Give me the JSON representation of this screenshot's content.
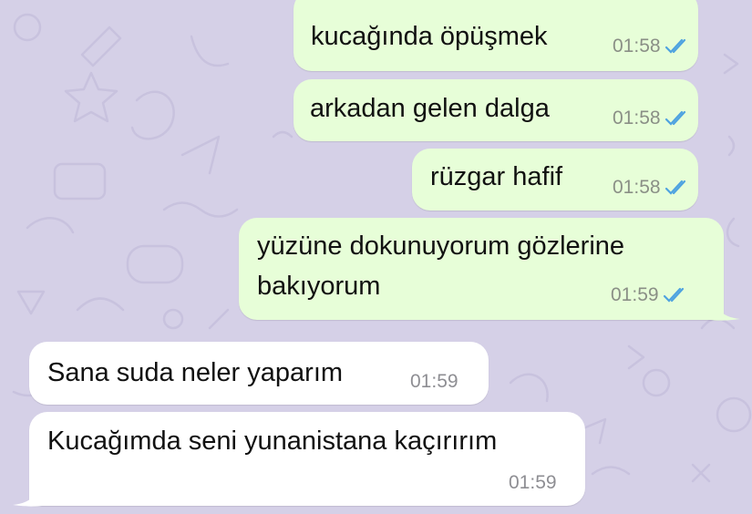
{
  "messages": [
    {
      "direction": "outgoing",
      "text": "kucağında öpüşmek",
      "time": "01:58",
      "status": "read-double-check-icon"
    },
    {
      "direction": "outgoing",
      "text": "arkadan gelen dalga",
      "time": "01:58",
      "status": "read-double-check-icon"
    },
    {
      "direction": "outgoing",
      "text": "rüzgar hafif",
      "time": "01:58",
      "status": "read-double-check-icon"
    },
    {
      "direction": "outgoing",
      "text_line1": "yüzüne dokunuyorum gözlerine",
      "text_line2": "bakıyorum",
      "time": "01:59",
      "status": "read-double-check-icon"
    },
    {
      "direction": "incoming",
      "text": "Sana suda neler yaparım",
      "time": "01:59"
    },
    {
      "direction": "incoming",
      "text": "Kucağımda seni yunanistana kaçırırım",
      "time": "01:59"
    }
  ],
  "colors": {
    "background": "#d5d0e7",
    "outgoing_bubble": "#e7fed8",
    "incoming_bubble": "#ffffff",
    "read_ticks": "#4fa3e0"
  }
}
